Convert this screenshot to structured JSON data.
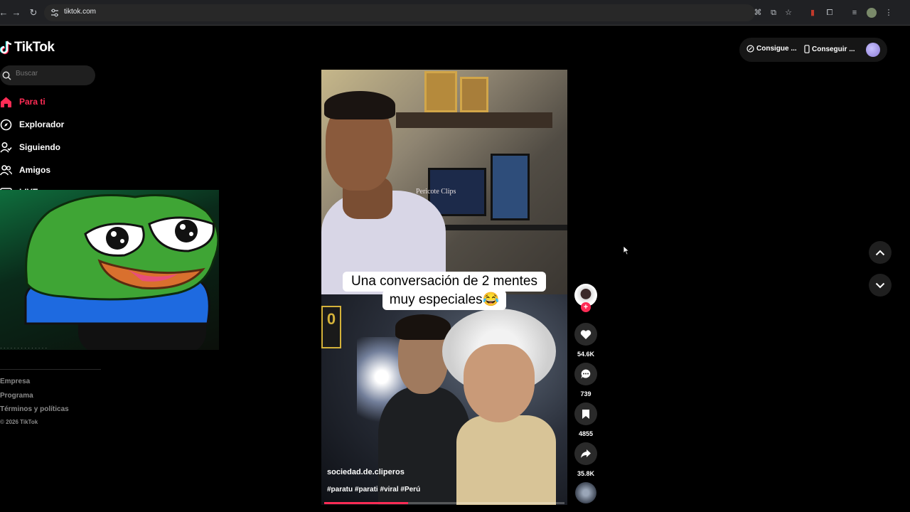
{
  "browser": {
    "url": "tiktok.com",
    "icons": [
      "back-icon",
      "forward-icon",
      "reload-icon",
      "site-info-icon",
      "translate-icon",
      "install-icon",
      "star-icon",
      "extension-icon",
      "puzzle-icon",
      "reading-list-icon",
      "profile-icon",
      "menu-icon"
    ]
  },
  "brand": {
    "name": "TikTok"
  },
  "search": {
    "placeholder": "Buscar"
  },
  "sidebar": {
    "items": [
      {
        "label": "Para ti",
        "icon": "home-icon",
        "active": true
      },
      {
        "label": "Explorador",
        "icon": "compass-icon",
        "active": false
      },
      {
        "label": "Siguiendo",
        "icon": "following-icon",
        "active": false
      },
      {
        "label": "Amigos",
        "icon": "friends-icon",
        "active": false
      },
      {
        "label": "LIVE",
        "icon": "live-icon",
        "active": false
      }
    ],
    "footer_links": [
      "Empresa",
      "Programa",
      "Términos y políticas"
    ],
    "copyright": "© 2026 TikTok"
  },
  "header": {
    "get_coins": "Consigue ...",
    "get_app": "Conseguir ..."
  },
  "video": {
    "watermark": "Pericote Clips",
    "caption_line1": "Una conversación de 2 mentes",
    "caption_line2": "muy especiales😂",
    "author": "sociedad.de.cliperos",
    "hashtags": "#paratu #parati #viral #Perú",
    "progress": 0.35,
    "side_label": "0"
  },
  "actions": {
    "likes": "54.6K",
    "comments": "739",
    "saves": "4855",
    "shares": "35.8K"
  },
  "colors": {
    "accent": "#fe2c55",
    "background": "#000000",
    "muted": "#8a8a8a"
  }
}
